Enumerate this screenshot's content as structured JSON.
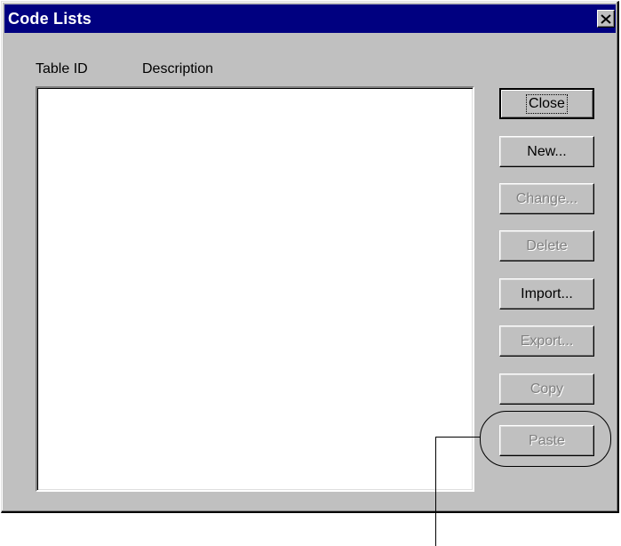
{
  "window": {
    "title": "Code Lists",
    "close_icon": "close-icon"
  },
  "list": {
    "columns": [
      "Table ID",
      "Description"
    ],
    "rows": []
  },
  "buttons": [
    {
      "label": "Close",
      "enabled": true,
      "default": true
    },
    {
      "label": "New...",
      "enabled": true
    },
    {
      "label": "Change...",
      "enabled": false
    },
    {
      "label": "Delete",
      "enabled": false
    },
    {
      "label": "Import...",
      "enabled": true
    },
    {
      "label": "Export...",
      "enabled": false
    },
    {
      "label": "Copy",
      "enabled": false
    },
    {
      "label": "Paste",
      "enabled": false
    }
  ],
  "colors": {
    "title_bar": "#000080",
    "dialog_face": "#c0c0c0",
    "disabled_text": "#808080"
  }
}
